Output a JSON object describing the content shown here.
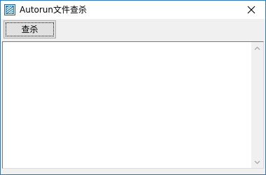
{
  "window": {
    "title": "Autorun文件查杀",
    "app_icon": "autorun-app-icon",
    "close_icon": "close-icon",
    "accent_color": "#2b79b8"
  },
  "toolbar": {
    "scan_label": "查杀"
  },
  "results": {
    "items": [],
    "scrollbar_icons": [
      "scroll-up-arrow-icon",
      "scroll-down-arrow-icon"
    ]
  }
}
